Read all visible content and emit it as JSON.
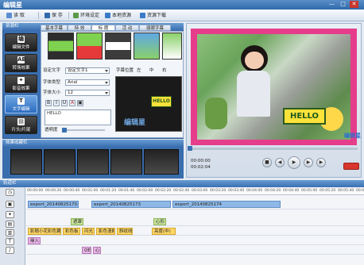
{
  "app": {
    "title": "编辑星",
    "window_buttons": [
      "—",
      "□",
      "✕"
    ]
  },
  "toolbar": {
    "read": "读 取",
    "save": "保 存",
    "settings": "环境设定",
    "local": "本地资源",
    "download": "资源下载"
  },
  "resource": {
    "title": "资源栏",
    "nav": [
      {
        "label": "编辑文件",
        "icon": "编"
      },
      {
        "label": "转场效果",
        "icon": "AB"
      },
      {
        "label": "影音效果",
        "icon": "✦"
      },
      {
        "label": "文字编辑",
        "icon": "T"
      },
      {
        "label": "片头/片尾",
        "icon": "▤"
      }
    ],
    "tabs": [
      "基本字幕",
      "特 效",
      "标 题",
      "活 动",
      "弱眼字幕"
    ],
    "form": {
      "text_setting_label": "设定文字",
      "text_setting_value": "设定文字1",
      "position_label": "字幕位置",
      "pos_left": "左",
      "pos_center": "中",
      "pos_right": "右",
      "font_type_label": "字体类型",
      "font_type_value": "Arial",
      "font_size_label": "字体大小",
      "font_size_value": "12",
      "text_content": "HELLO",
      "transparency_label": "透明度",
      "fmt": [
        "B",
        "I",
        "U",
        "A",
        "▣"
      ]
    },
    "preview_hello": "HELLO",
    "watermark": "编辑星"
  },
  "effects": {
    "title": "效果收藏栏"
  },
  "player": {
    "time_current": "00:00:00",
    "time_total": "00:02:04",
    "hello": "HELLO",
    "logo": "编辑星"
  },
  "timeline": {
    "title": "轨道栏",
    "ruler": [
      "00:00:00",
      "00:00:20",
      "00:00:40",
      "00:01:00",
      "00:01:20",
      "00:01:40",
      "00:02:00",
      "00:02:20",
      "00:02:40",
      "00:03:00",
      "00:03:20",
      "00:03:40",
      "00:04:00",
      "00:04:20",
      "00:04:40",
      "00:05:00",
      "00:05:20",
      "00:05:40",
      "00:06:00"
    ],
    "video_clips": [
      "export_20140825170",
      "export_20140825173",
      "export_20140825174"
    ],
    "fx_row": [
      "遮罩",
      "心形"
    ],
    "transition_clips": [
      "影随小花彩色翼合",
      "彩色板",
      "闪光",
      "影色漫射",
      "斜纹线",
      "亮度(中)"
    ],
    "sub_row": [
      "缘入"
    ],
    "title_row": [
      "OEB",
      "心"
    ]
  }
}
